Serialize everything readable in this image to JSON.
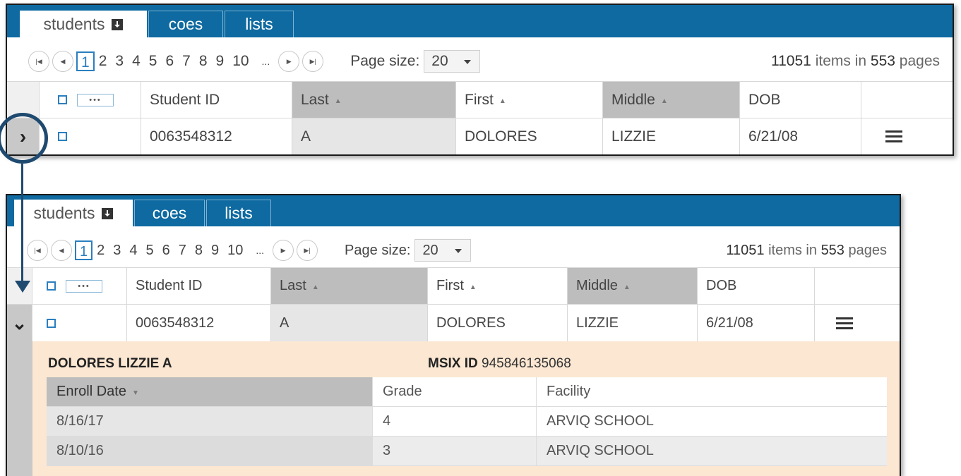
{
  "tabs": [
    {
      "label": "students",
      "active": true,
      "icon": "download-icon"
    },
    {
      "label": "coes",
      "active": false
    },
    {
      "label": "lists",
      "active": false
    }
  ],
  "pager": {
    "first_icon": "first-page-icon",
    "prev_icon": "prev-page-icon",
    "pages": [
      "1",
      "2",
      "3",
      "4",
      "5",
      "6",
      "7",
      "8",
      "9",
      "10"
    ],
    "current_page": "1",
    "ellipsis": "...",
    "next_icon": "next-page-icon",
    "last_icon": "last-page-icon",
    "page_size_label": "Page size:",
    "page_size_value": "20",
    "item_count": "11051",
    "items_in_text": "items in",
    "page_count": "553",
    "pages_text": "pages"
  },
  "grid": {
    "more_label": "•••",
    "columns": [
      "Student ID",
      "Last",
      "First",
      "Middle",
      "DOB"
    ],
    "sorted_columns": [
      "Last",
      "First",
      "Middle"
    ],
    "row": {
      "student_id": "0063548312",
      "last": "A",
      "first": "DOLORES",
      "middle": "LIZZIE",
      "dob": "6/21/08"
    },
    "collapsed_expander": "›",
    "expanded_expander": "⌄",
    "menu_icon": "hamburger-menu-icon"
  },
  "detail": {
    "name": "DOLORES LIZZIE A",
    "msix_label": "MSIX ID",
    "msix_value": "945846135068",
    "columns": [
      "Enroll Date",
      "Grade",
      "Facility"
    ],
    "rows": [
      {
        "enroll_date": "8/16/17",
        "grade": "4",
        "facility": "ARVIQ SCHOOL"
      },
      {
        "enroll_date": "8/10/16",
        "grade": "3",
        "facility": "ARVIQ SCHOOL"
      }
    ]
  },
  "colors": {
    "tabbar": "#0e6aa0",
    "callout": "#1f4a70",
    "detail_bg": "#fbe7d2",
    "sorted_header": "#bdbdbd"
  }
}
